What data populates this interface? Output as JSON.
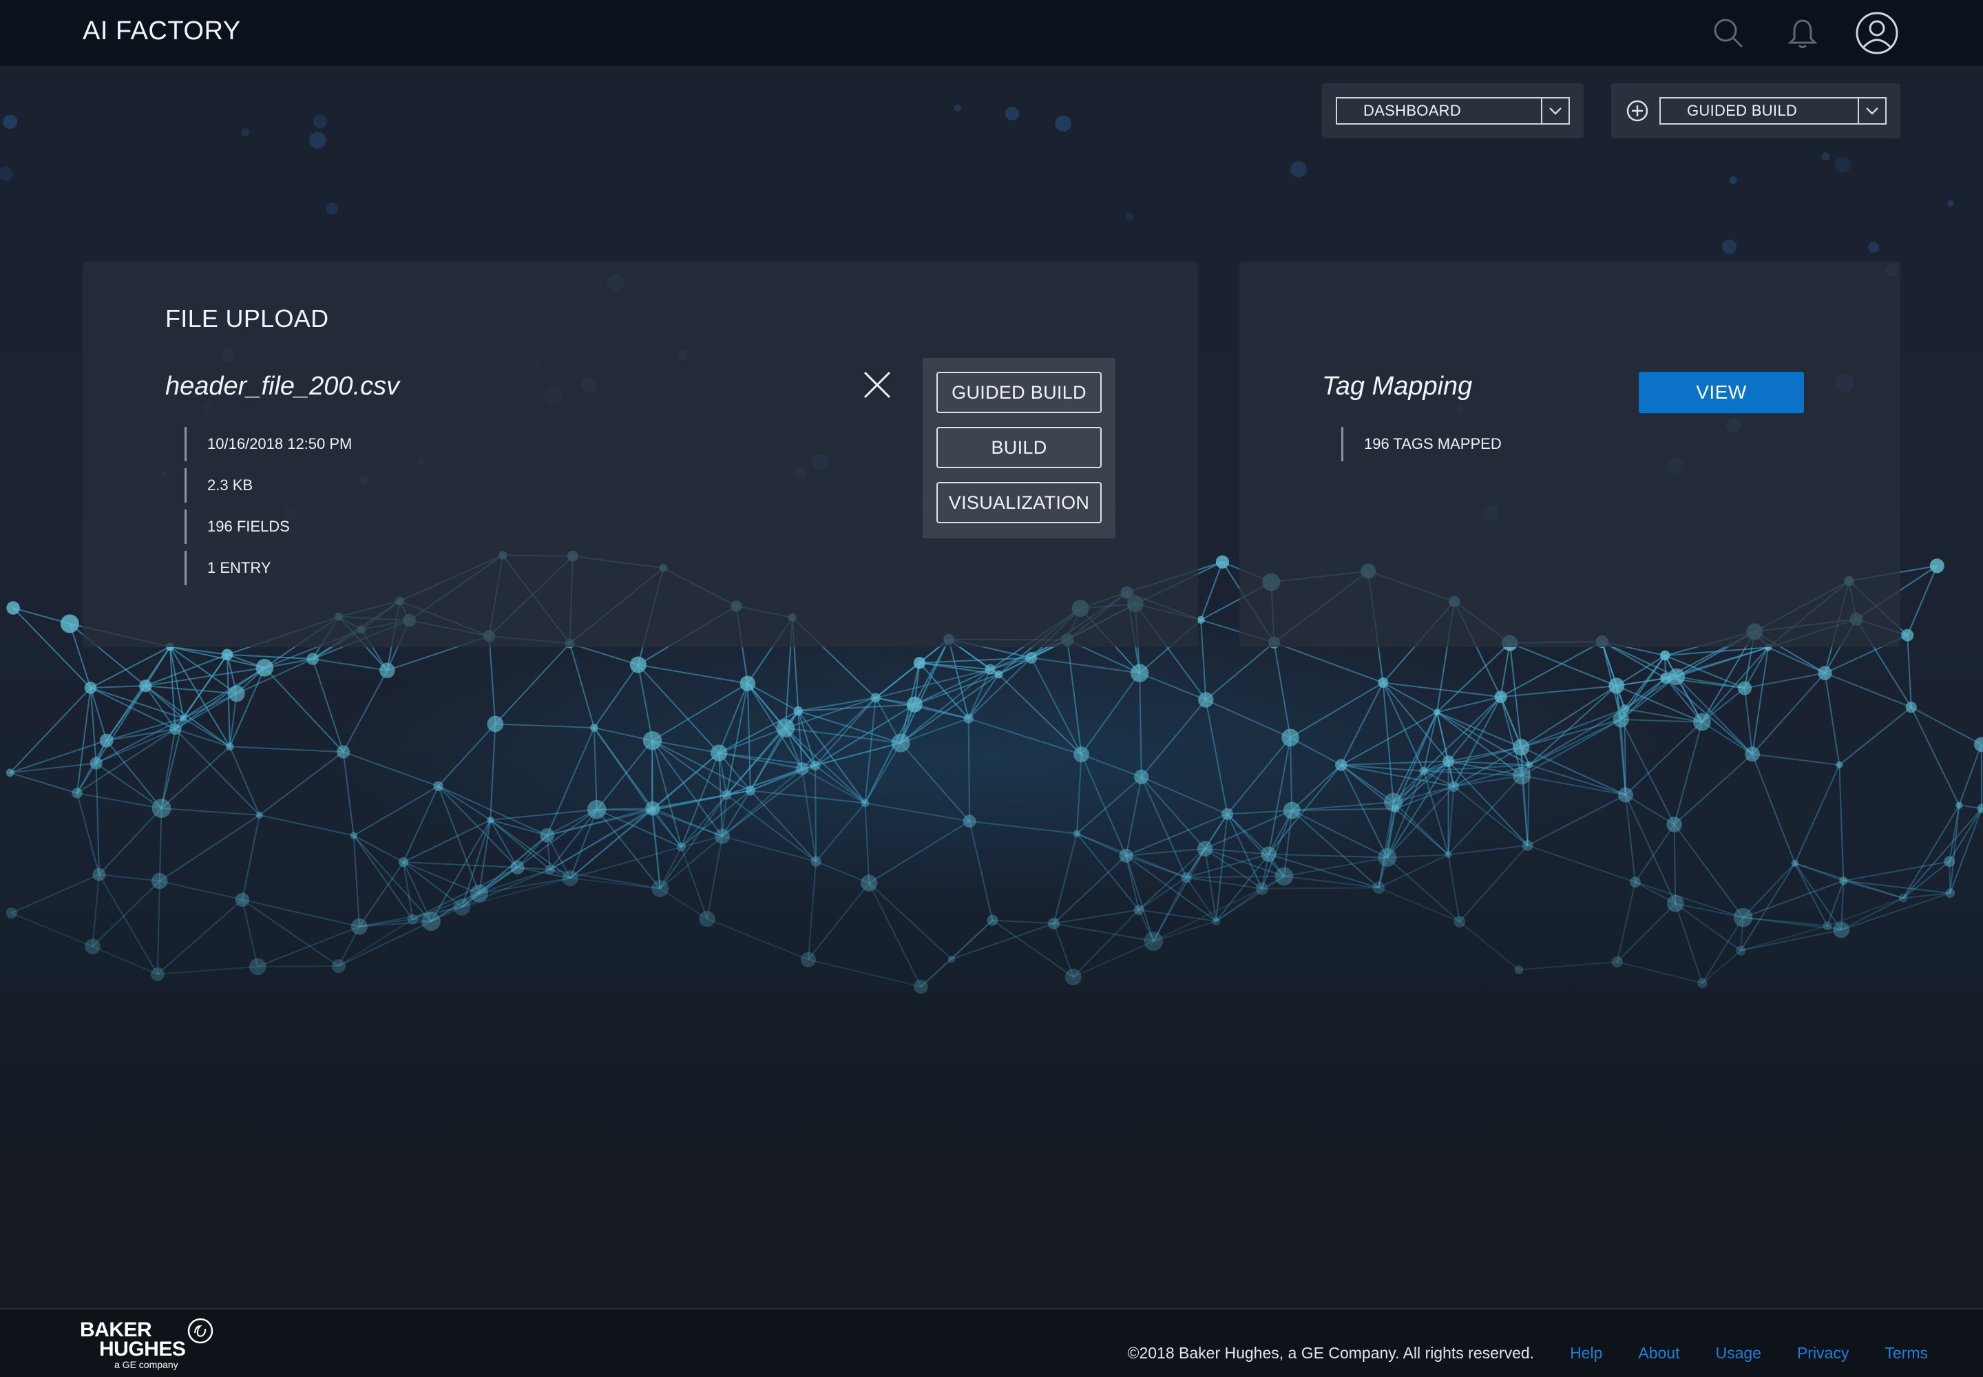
{
  "header": {
    "title": "AI FACTORY",
    "icons": [
      "search-icon",
      "bell-icon",
      "user-icon"
    ]
  },
  "toolbar": {
    "dashboard_select": "DASHBOARD",
    "build_select": "GUIDED BUILD"
  },
  "file_upload": {
    "heading": "FILE UPLOAD",
    "file_name": "header_file_200.csv",
    "meta": [
      "10/16/2018  12:50 PM",
      "2.3 KB",
      "196 FIELDS",
      "1 ENTRY"
    ],
    "actions": [
      "GUIDED BUILD",
      "BUILD",
      "VISUALIZATION"
    ]
  },
  "tag_mapping": {
    "title": "Tag Mapping",
    "view_label": "VIEW",
    "meta": "196  TAGS MAPPED"
  },
  "footer": {
    "logo_line1": "BAKER",
    "logo_line2": "HUGHES",
    "logo_line3": "a GE company",
    "copyright": "©2018 Baker Hughes, a GE Company. All rights reserved.",
    "links": [
      "Help",
      "About",
      "Usage",
      "Privacy",
      "Terms"
    ]
  },
  "colors": {
    "accent": "#0a73c7",
    "link": "#1e7fd6",
    "header_bg": "#0c121b",
    "page_bg": "#151b23"
  }
}
